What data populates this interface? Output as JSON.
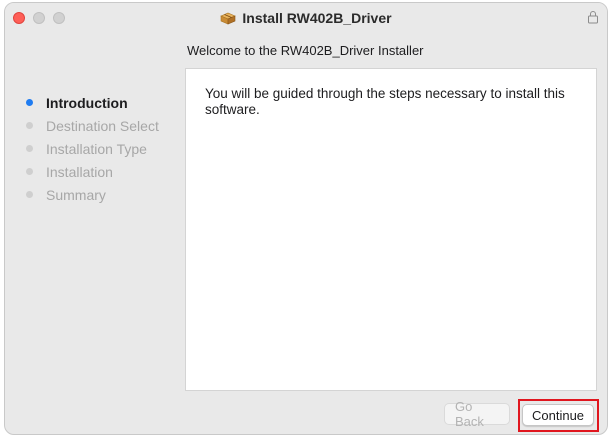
{
  "window": {
    "title": "Install RW402B_Driver",
    "title_icon": "package-icon",
    "lock_icon": "lock-icon"
  },
  "header": {
    "subtitle": "Welcome to the RW402B_Driver Installer"
  },
  "sidebar": {
    "steps": [
      {
        "label": "Introduction",
        "active": true
      },
      {
        "label": "Destination Select",
        "active": false
      },
      {
        "label": "Installation Type",
        "active": false
      },
      {
        "label": "Installation",
        "active": false
      },
      {
        "label": "Summary",
        "active": false
      }
    ]
  },
  "main": {
    "body_text": "You will be guided through the steps necessary to install this software."
  },
  "footer": {
    "back_label": "Go Back",
    "continue_label": "Continue"
  },
  "colors": {
    "active_step": "#1f7cf1",
    "highlight": "#e0161e",
    "close_button": "#fe5f57"
  }
}
